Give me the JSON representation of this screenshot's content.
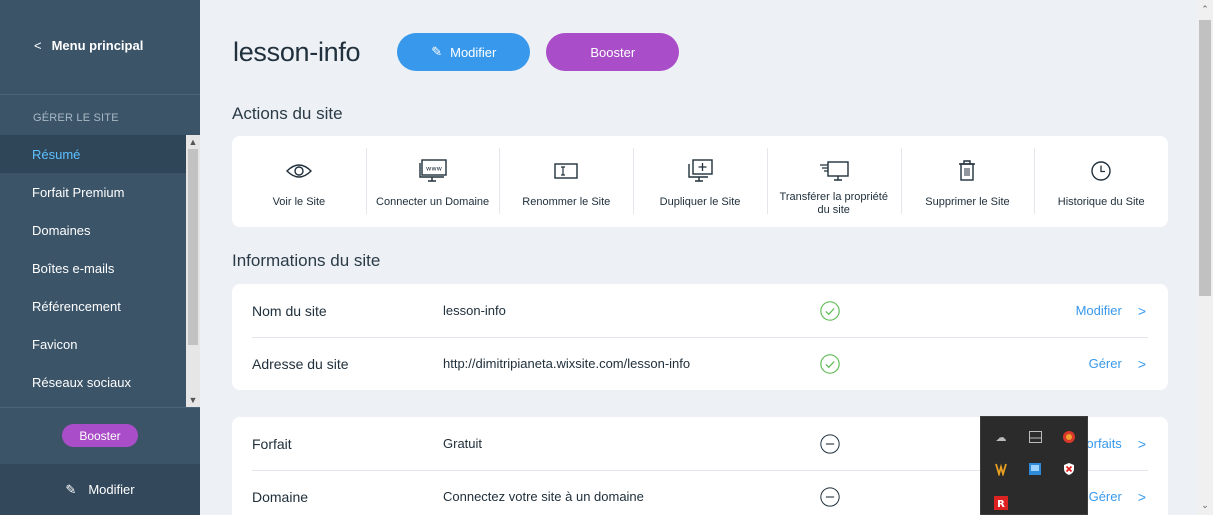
{
  "sidebar": {
    "back_label": "Menu principal",
    "back_icon": "chevron-left-icon",
    "section_title": "GÉRER LE SITE",
    "items": [
      {
        "label": "Résumé",
        "active": true
      },
      {
        "label": "Forfait Premium"
      },
      {
        "label": "Domaines"
      },
      {
        "label": "Boîtes e-mails"
      },
      {
        "label": "Référencement"
      },
      {
        "label": "Favicon"
      },
      {
        "label": "Réseaux sociaux"
      }
    ],
    "boost_label": "Booster",
    "modify_label": "Modifier"
  },
  "header": {
    "title": "lesson-info",
    "modify_label": "Modifier",
    "boost_label": "Booster"
  },
  "actions_section": {
    "title": "Actions du site",
    "items": [
      {
        "label": "Voir le Site",
        "icon": "eye-icon"
      },
      {
        "label": "Connecter un Domaine",
        "icon": "www-monitor-icon"
      },
      {
        "label": "Renommer le Site",
        "icon": "text-cursor-icon"
      },
      {
        "label": "Dupliquer le Site",
        "icon": "duplicate-monitor-icon"
      },
      {
        "label": "Transférer la propriété du site",
        "icon": "transfer-monitor-icon"
      },
      {
        "label": "Supprimer le Site",
        "icon": "trash-icon"
      },
      {
        "label": "Historique du Site",
        "icon": "clock-icon"
      }
    ]
  },
  "info_section": {
    "title": "Informations du site",
    "rows": [
      {
        "key": "Nom du site",
        "value": "lesson-info",
        "status": "check",
        "action": "Modifier"
      },
      {
        "key": "Adresse du site",
        "value": "http://dimitripianeta.wixsite.com/lesson-info",
        "status": "check",
        "action": "Gérer"
      }
    ]
  },
  "plan_section": {
    "rows": [
      {
        "key": "Forfait",
        "value": "Gratuit",
        "status": "minus",
        "action": "Forfaits"
      },
      {
        "key": "Domaine",
        "value": "Connectez votre site à un domaine",
        "status": "minus",
        "action": "Gérer"
      }
    ]
  },
  "colors": {
    "sidebar_bg": "#3b5468",
    "accent_blue": "#3899ec",
    "accent_purple": "#aa4dc8",
    "success_green": "#60bc57"
  }
}
